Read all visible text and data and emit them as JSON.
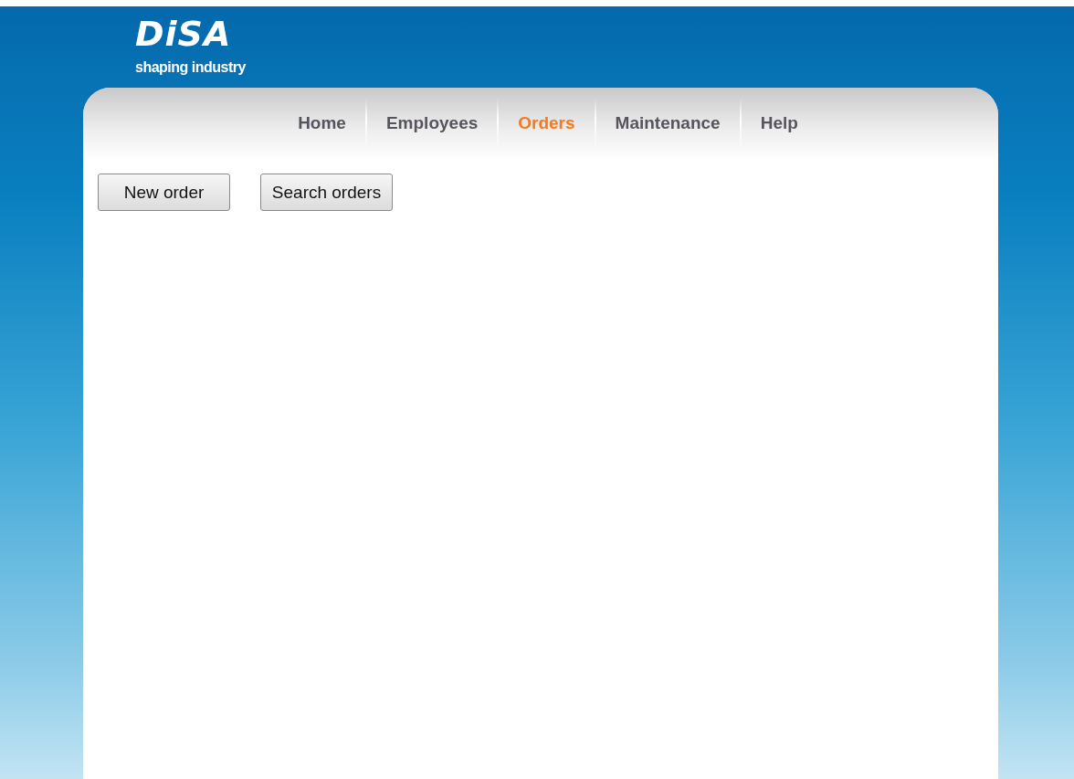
{
  "logo": {
    "name": "DiSA",
    "tagline": "shaping industry"
  },
  "nav": [
    {
      "label": "Home",
      "selected": false
    },
    {
      "label": "Employees",
      "selected": false
    },
    {
      "label": "Orders",
      "selected": true
    },
    {
      "label": "Maintenance",
      "selected": false
    },
    {
      "label": "Help",
      "selected": false
    }
  ],
  "buttons": [
    "New order",
    "Search orders"
  ]
}
